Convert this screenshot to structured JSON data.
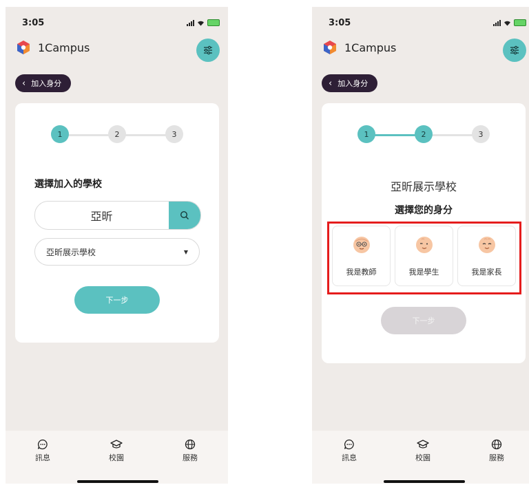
{
  "status_bar": {
    "time": "3:05"
  },
  "app": {
    "name": "1Campus"
  },
  "back_button": {
    "label": "加入身分"
  },
  "stepper": {
    "steps": [
      "1",
      "2",
      "3"
    ]
  },
  "left_screen": {
    "current_step": 1,
    "section_title": "選擇加入的學校",
    "search": {
      "value": "亞昕"
    },
    "school_select": {
      "selected": "亞昕展示學校"
    },
    "next_button": "下一步"
  },
  "right_screen": {
    "current_step": 2,
    "school_name": "亞昕展示學校",
    "role_title": "選擇您的身分",
    "roles": [
      {
        "label": "我是教師",
        "icon": "teacher-face-icon"
      },
      {
        "label": "我是學生",
        "icon": "student-face-icon"
      },
      {
        "label": "我是家長",
        "icon": "parent-face-icon"
      }
    ],
    "next_button": "下一步",
    "next_button_state": "disabled"
  },
  "bottom_nav": [
    {
      "label": "訊息",
      "icon": "message-icon"
    },
    {
      "label": "校園",
      "icon": "campus-icon"
    },
    {
      "label": "服務",
      "icon": "globe-icon"
    }
  ],
  "colors": {
    "accent": "#5bc1c0",
    "back_pill": "#2e1f36",
    "background": "#efebe8",
    "highlight_frame": "#e51c1c"
  }
}
